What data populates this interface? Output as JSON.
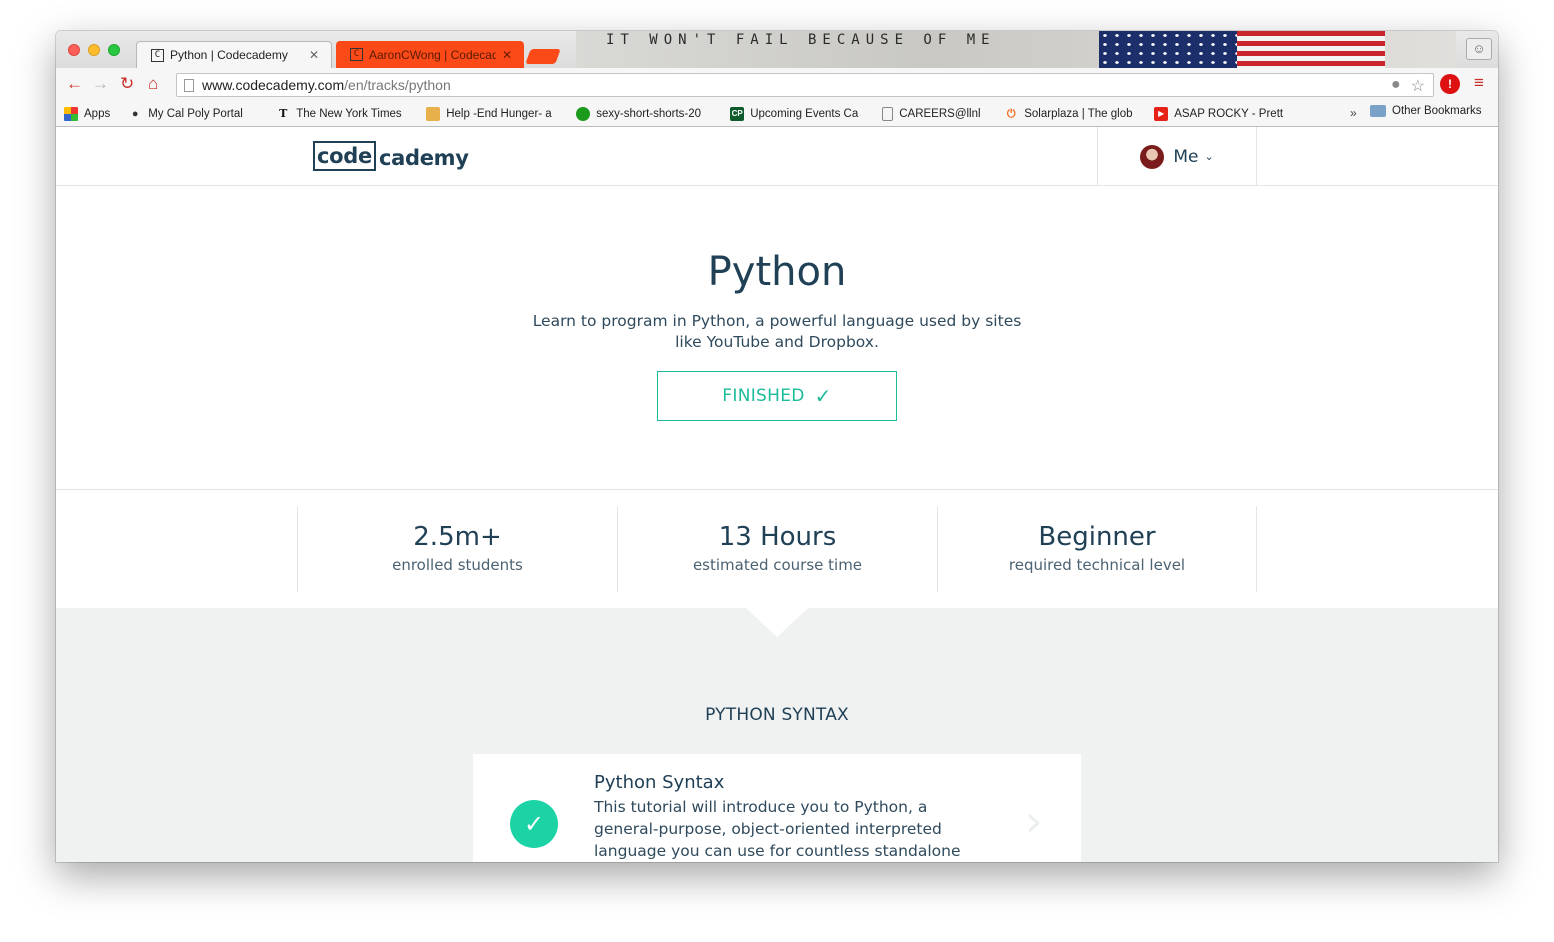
{
  "browser": {
    "tabs": [
      {
        "title": "Python | Codecademy",
        "favicon": "C"
      },
      {
        "title": "AaronCWong | Codecademy",
        "favicon": "C"
      }
    ],
    "wallpaper_text": "IT WON'T FAIL BECAUSE OF ME",
    "url": {
      "host": "www.codecademy.com",
      "path": "/en/tracks/python"
    },
    "bookmarks": [
      {
        "label": "Apps",
        "icon": "apps-grid-icon"
      },
      {
        "label": "My Cal Poly Portal",
        "icon": "lock-icon"
      },
      {
        "label": "The New York Times",
        "icon": "nyt-icon"
      },
      {
        "label": "Help -End Hunger- a",
        "icon": "help-icon"
      },
      {
        "label": "sexy-short-shorts-20",
        "icon": "circle-icon"
      },
      {
        "label": "Upcoming Events Ca",
        "icon": "cp-icon"
      },
      {
        "label": "CAREERS@llnl",
        "icon": "page-icon"
      },
      {
        "label": "Solarplaza | The glob",
        "icon": "power-icon"
      },
      {
        "label": "ASAP ROCKY - Prett",
        "icon": "youtube-icon"
      }
    ],
    "bookmarks_overflow": "»",
    "other_bookmarks": "Other Bookmarks"
  },
  "site": {
    "logo_box": "code",
    "logo_rest": "cademy",
    "user_menu": "Me"
  },
  "hero": {
    "title": "Python",
    "description": "Learn to program in Python, a powerful language used by sites like YouTube and Dropbox.",
    "status_button": "FINISHED"
  },
  "stats": [
    {
      "value": "2.5m+",
      "label": "enrolled students"
    },
    {
      "value": "13 Hours",
      "label": "estimated course time"
    },
    {
      "value": "Beginner",
      "label": "required technical level"
    }
  ],
  "syllabus": {
    "heading": "PYTHON SYNTAX",
    "lesson": {
      "title": "Python Syntax",
      "description": "This tutorial will introduce you to Python, a general-purpose, object-oriented interpreted language you can use for countless standalone projects or scripting",
      "completed": true
    }
  },
  "colors": {
    "accent": "#1bbc9b",
    "navy": "#204056",
    "tab_orange": "#fb4a17"
  }
}
